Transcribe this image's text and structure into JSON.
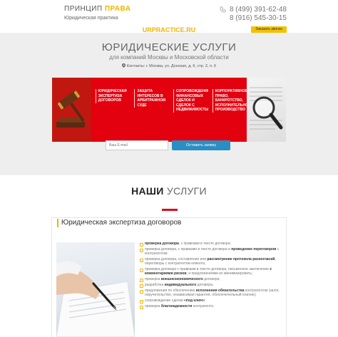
{
  "header": {
    "logo_word1": "ПРИНЦИП",
    "logo_word2": "ПРАВА",
    "logo_sub": "Юридическая практика",
    "phone1": "8 (499) 391-62-48",
    "phone2": "8 (916) 545-30-15",
    "callback_label": "Заказать звонок"
  },
  "hero": {
    "site_name": "URPRACTICE.RU",
    "title": "ЮРИДИЧЕСКИЕ УСЛУГИ",
    "subtitle": "для компаний Москвы и Московской области",
    "address": "Контакты: г. Москва, ул. Донская, д. 6, стр. 2, п. 6",
    "cards": [
      {
        "label": "юридическая экспертиза договоров"
      },
      {
        "label": "защита интересов в арбитражном суде"
      },
      {
        "label": "сопровождение финансовых сделок и сделок с недвижимостью"
      },
      {
        "label": "корпоративное право, банкротство, исполнительное производство"
      }
    ],
    "email_placeholder": "Ваш E-mail",
    "subscribe_label": "Оставить заявку"
  },
  "services": {
    "title_word1": "НАШИ",
    "title_word2": "УСЛУГИ",
    "section_title": "Юридическая экспертиза договоров",
    "items": [
      {
        "pre": "",
        "bold": "проверка договора",
        "post": ", с правками в тексте договора;"
      },
      {
        "pre": "проверка договора, с правками в тексте договора и ",
        "bold": "проведение переговоров",
        "post": " с контрагентом;"
      },
      {
        "pre": "проверка договора, составление или ",
        "bold": "рассмотрение протокола разногласий",
        "post": ", переговоры с контрагентом клиента;"
      },
      {
        "pre": "проверка договора с правками в тексте договора, письменное заключение ",
        "bold": "с комментариями рисков",
        "post": ", и предложениями их минимизировать;"
      },
      {
        "pre": "проверка ",
        "bold": "внешнеэкономического",
        "post": " договора;"
      },
      {
        "pre": "разработка ",
        "bold": "индивидуального",
        "post": " договора;"
      },
      {
        "pre": "предложения по обеспечению ",
        "bold": "исполнения обязательства",
        "post": " контрагентом (залог, поручительство, независимая гарантия, обеспечительный платеж);"
      },
      {
        "pre": "сопровождение сделки ",
        "bold": "«под ключ»",
        "post": ";"
      },
      {
        "pre": "проверка ",
        "bold": "благонадежности",
        "post": " контрагента."
      }
    ]
  },
  "colors": {
    "accent": "#f2b200",
    "red": "#e3000f",
    "blue": "#2a8ec4"
  }
}
